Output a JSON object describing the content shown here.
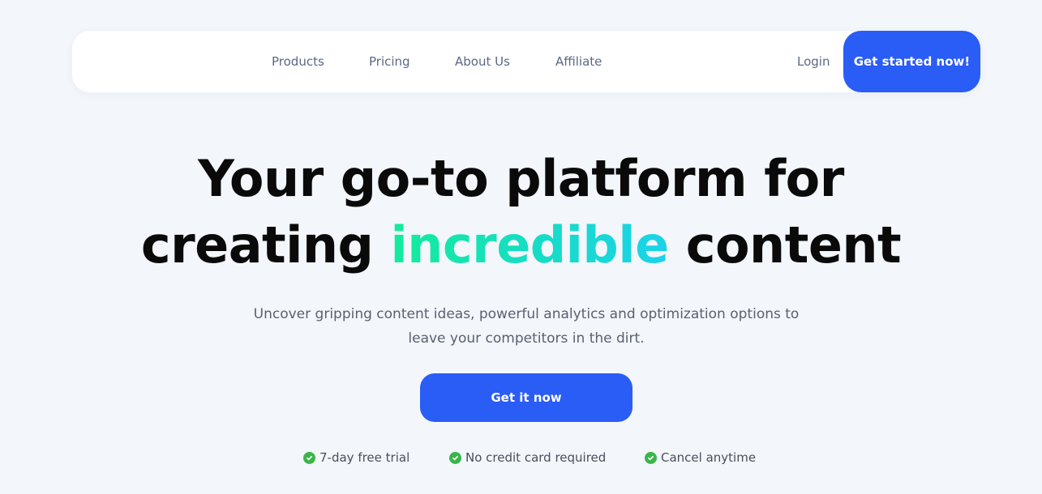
{
  "nav": {
    "links": [
      "Products",
      "Pricing",
      "About Us",
      "Affiliate"
    ],
    "login": "Login",
    "cta": "Get started now!"
  },
  "hero": {
    "title_line1": "Your go-to platform for",
    "title_line2_before": "creating ",
    "title_highlight": "incredible",
    "title_line2_after": " content",
    "subtitle": "Uncover gripping content ideas, powerful analytics and optimization options to leave your competitors in the dirt.",
    "cta": "Get it now"
  },
  "features": [
    {
      "icon": "check-circle-icon",
      "label": "7-day free trial"
    },
    {
      "icon": "check-circle-icon",
      "label": "No credit card required"
    },
    {
      "icon": "check-circle-icon",
      "label": "Cancel anytime"
    }
  ],
  "colors": {
    "accent": "#2a5cf6",
    "highlight_start": "#14ec9b",
    "highlight_end": "#1cd2ea",
    "check": "#3bb54a",
    "background": "#f3f6fb"
  }
}
